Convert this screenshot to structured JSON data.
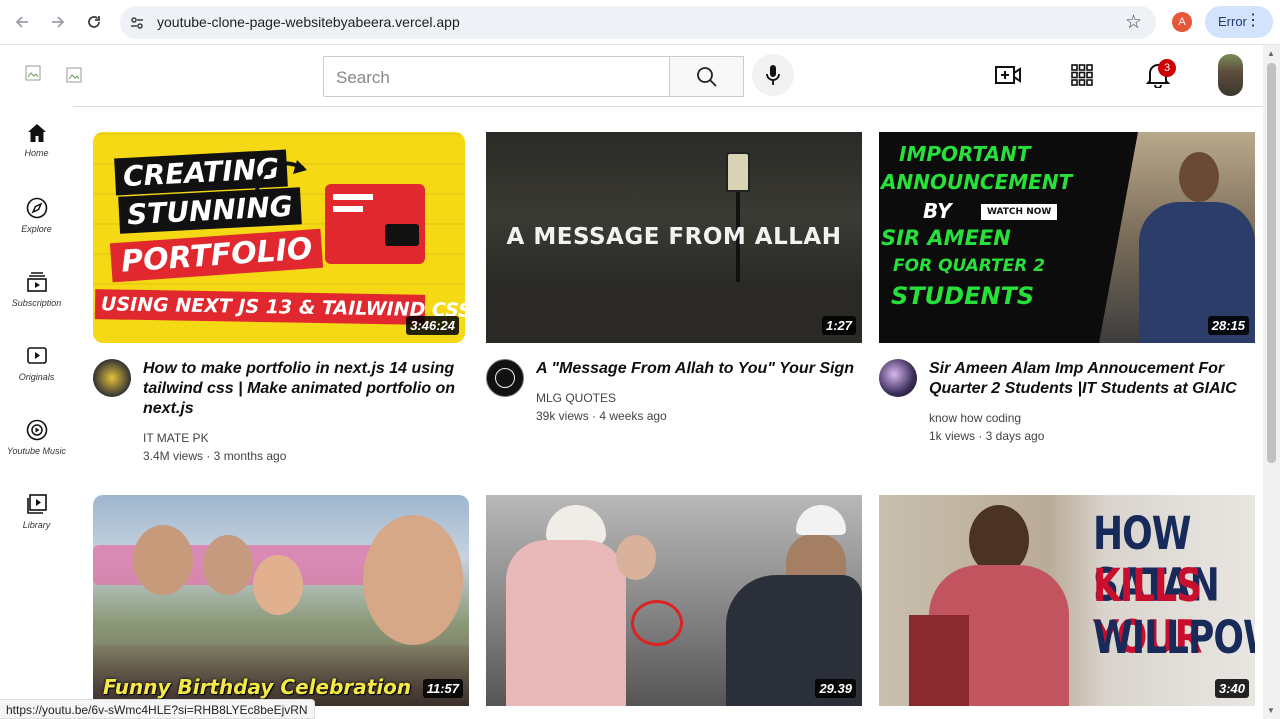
{
  "browser": {
    "url": "youtube-clone-page-websitebyabeera.vercel.app",
    "profile_initial": "A",
    "error_label": "Error",
    "status_url": "https://youtu.be/6v-sWmc4HLE?si=RHB8LYEc8beEjvRN"
  },
  "header": {
    "search_placeholder": "Search",
    "notification_count": "3"
  },
  "sidebar": {
    "items": [
      {
        "label": "Home",
        "icon": "home-icon"
      },
      {
        "label": "Explore",
        "icon": "compass-icon"
      },
      {
        "label": "Subscription",
        "icon": "subscriptions-icon"
      },
      {
        "label": "Originals",
        "icon": "originals-icon"
      },
      {
        "label": "Youtube Music",
        "icon": "music-icon"
      },
      {
        "label": "Library",
        "icon": "library-icon"
      }
    ]
  },
  "videos": [
    {
      "title": "How to make portfolio in next.js 14 using tailwind css | Make animated portfolio on next.js",
      "channel": "IT MATE PK",
      "stats": "3.4M views · 3 months ago",
      "duration": "3:46:24",
      "thumb_lines": [
        "CREATING",
        "STUNNING",
        "PORTFOLIO",
        "USING NEXT JS 13 & TAILWIND CSS"
      ]
    },
    {
      "title": "A \"Message From Allah to You\" Your Sign",
      "channel": "MLG QUOTES",
      "stats": "39k views · 4 weeks ago",
      "duration": "1:27",
      "thumb_lines": [
        "A MESSAGE FROM ALLAH"
      ]
    },
    {
      "title": "Sir Ameen Alam Imp Annoucement For Quarter 2 Students |IT Students at GIAIC",
      "channel": "know how coding",
      "stats": "1k views · 3 days ago",
      "duration": "28:15",
      "thumb_lines": [
        "IMPORTANT",
        "ANNOUNCEMENT",
        "BY",
        "SIR AMEEN",
        "FOR QUARTER 2",
        "STUDENTS",
        "WATCH NOW"
      ]
    },
    {
      "duration": "11:57",
      "thumb_lines": [
        "Funny Birthday Celebration"
      ]
    },
    {
      "duration": "29.39",
      "thumb_lines": []
    },
    {
      "duration": "3:40",
      "thumb_lines": [
        "HOW SATAN",
        "KILLS YOUR",
        "WILLPOWER"
      ]
    }
  ]
}
